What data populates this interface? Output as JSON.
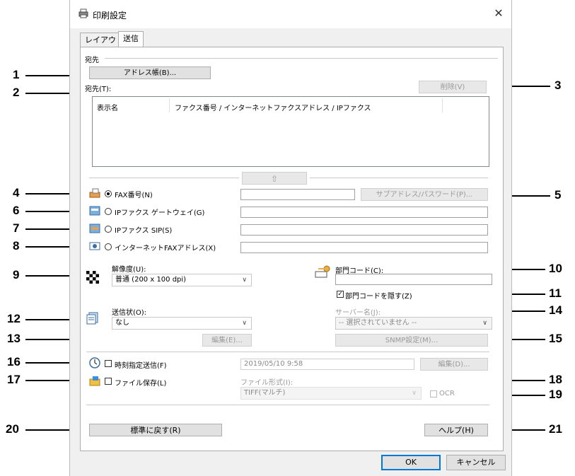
{
  "window": {
    "title": "印刷設定",
    "close_glyph": "✕"
  },
  "tabs": [
    {
      "label": "レイアウト",
      "active": false
    },
    {
      "label": "送信",
      "active": true
    }
  ],
  "destination": {
    "group_label": "宛先",
    "address_book_button": "アドレス帳(B)...",
    "destination_label": "宛先(T):",
    "delete_button": "削除(V)",
    "columns": [
      "表示名",
      "ファクス番号 / インターネットファクスアドレス / IPファクス"
    ],
    "move_up_glyph": "⇧"
  },
  "methods": {
    "fax": {
      "label": "FAX番号(N)",
      "selected": true,
      "value": ""
    },
    "subaddress_button": "サブアドレス/パスワード(P)...",
    "ip_gateway": {
      "label": "IPファクス ゲートウェイ(G)",
      "selected": false
    },
    "ip_sip": {
      "label": "IPファクス SIP(S)",
      "selected": false
    },
    "internet_fax": {
      "label": "インターネットFAXアドレス(X)",
      "selected": false
    }
  },
  "resolution": {
    "label": "解像度(U):",
    "value": "普通 (200 x 100 dpi)"
  },
  "department": {
    "label": "部門コード(C):",
    "value": "",
    "hide_label": "部門コードを隠す(Z)",
    "hide_checked": true
  },
  "cover": {
    "label": "送信状(O):",
    "value": "なし",
    "edit_button": "編集(E)..."
  },
  "server": {
    "label": "サーバー名(J):",
    "value": "-- 選択されていません --",
    "snmp_button": "SNMP設定(M)..."
  },
  "schedule": {
    "label": "時刻指定送信(F)",
    "checked": false,
    "value": "2019/05/10 9:58",
    "edit_button": "編集(D)..."
  },
  "file_save": {
    "label": "ファイル保存(L)",
    "checked": false,
    "format_label": "ファイル形式(I):",
    "format_value": "TIFF(マルチ)",
    "ocr_label": "OCR"
  },
  "footer": {
    "restore_button": "標準に戻す(R)",
    "help_button": "ヘルプ(H)",
    "ok_button": "OK",
    "cancel_button": "キャンセル"
  },
  "callouts": [
    "1",
    "2",
    "3",
    "4",
    "5",
    "6",
    "7",
    "8",
    "9",
    "10",
    "11",
    "12",
    "13",
    "14",
    "15",
    "16",
    "17",
    "18",
    "19",
    "20",
    "21"
  ]
}
